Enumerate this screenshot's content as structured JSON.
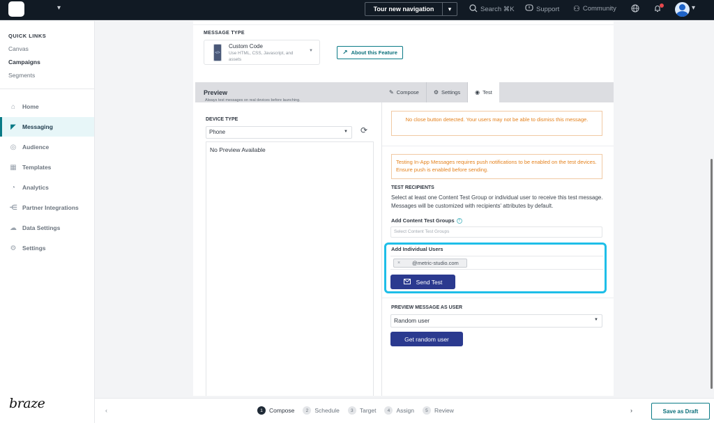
{
  "topbar": {
    "tour_label": "Tour new navigation",
    "search_label": "Search ⌘K",
    "support_label": "Support",
    "community_label": "Community",
    "icons": {
      "chevron": "▾",
      "search": "○",
      "support": "▭",
      "community": "⚇",
      "globe": "⊕",
      "bell": "🔔"
    },
    "notification_dot_color": "#e5484d"
  },
  "sidebar": {
    "quick_links_title": "QUICK LINKS",
    "quick_links": [
      {
        "label": "Canvas",
        "active": false
      },
      {
        "label": "Campaigns",
        "active": true
      },
      {
        "label": "Segments",
        "active": false
      }
    ],
    "nav": [
      {
        "label": "Home",
        "icon": "home-icon",
        "glyph": "⌂",
        "active": false
      },
      {
        "label": "Messaging",
        "icon": "megaphone-icon",
        "glyph": "◤",
        "active": true
      },
      {
        "label": "Audience",
        "icon": "audience-icon",
        "glyph": "◎",
        "active": false
      },
      {
        "label": "Templates",
        "icon": "templates-icon",
        "glyph": "▦",
        "active": false
      },
      {
        "label": "Analytics",
        "icon": "analytics-icon",
        "glyph": "◔",
        "active": false
      },
      {
        "label": "Partner Integrations",
        "icon": "integrations-icon",
        "glyph": "⋲",
        "active": false
      },
      {
        "label": "Data Settings",
        "icon": "cloud-icon",
        "glyph": "☁",
        "active": false
      },
      {
        "label": "Settings",
        "icon": "gear-icon",
        "glyph": "⚙",
        "active": false
      }
    ],
    "brand": "braze",
    "accent_color": "#0a7a86"
  },
  "message_type": {
    "label": "MESSAGE TYPE",
    "name": "Custom Code",
    "description": "Use HTML, CSS, Javascript, and assets",
    "about_label": "About this Feature"
  },
  "preview": {
    "title": "Preview",
    "subtitle": "Always test messages on real devices before launching.",
    "device_type_label": "DEVICE TYPE",
    "device_type_value": "Phone",
    "empty_text": "No Preview Available"
  },
  "tabs": [
    {
      "label": "Compose",
      "glyph": "✎",
      "active": false
    },
    {
      "label": "Settings",
      "glyph": "⚙",
      "active": false
    },
    {
      "label": "Test",
      "glyph": "◉",
      "active": true
    }
  ],
  "test": {
    "warning_close": "No close button detected. Your users may not be able to dismiss this message.",
    "warning_push": "Testing In-App Messages requires push notifications to be enabled on the test devices. Ensure push is enabled before sending.",
    "recipients_label": "TEST RECIPIENTS",
    "recipients_desc": "Select at least one Content Test Group or individual user to receive this test message. Messages will be customized with recipients' attributes by default.",
    "content_groups_label": "Add Content Test Groups",
    "content_groups_placeholder": "Select Content Test Groups",
    "individual_users_label": "Add Individual Users",
    "user_chip": "@metric-studio.com",
    "send_label": "Send Test",
    "preview_as_label": "PREVIEW MESSAGE AS USER",
    "preview_as_value": "Random user",
    "random_user_label": "Get random user",
    "warning_color": "#e4811c",
    "button_color": "#2b3a8f",
    "highlight_color": "#1ebee8"
  },
  "footer": {
    "steps": [
      {
        "num": "1",
        "label": "Compose",
        "active": true
      },
      {
        "num": "2",
        "label": "Schedule",
        "active": false
      },
      {
        "num": "3",
        "label": "Target",
        "active": false
      },
      {
        "num": "4",
        "label": "Assign",
        "active": false
      },
      {
        "num": "5",
        "label": "Review",
        "active": false
      }
    ],
    "save_draft_label": "Save as Draft",
    "prev_glyph": "‹",
    "next_glyph": "›"
  }
}
